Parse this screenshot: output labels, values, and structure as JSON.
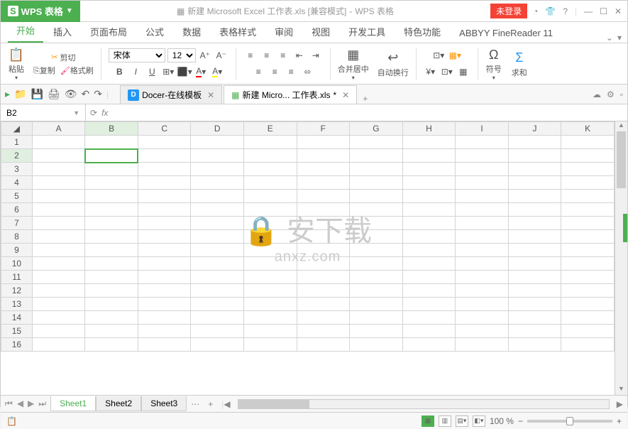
{
  "app": {
    "brand": "WPS 表格",
    "title_doc": "新建 Microsoft Excel 工作表.xls [兼容模式]",
    "title_suffix": "WPS 表格",
    "login": "未登录"
  },
  "menu_tabs": [
    "开始",
    "插入",
    "页面布局",
    "公式",
    "数据",
    "表格样式",
    "审阅",
    "视图",
    "开发工具",
    "特色功能",
    "ABBYY FineReader 11"
  ],
  "menu_active": 0,
  "ribbon": {
    "paste": "粘贴",
    "cut": "剪切",
    "copy": "复制",
    "format_painter": "格式刷",
    "font_name": "宋体",
    "font_size": "12",
    "merge": "合并居中",
    "wrap": "自动换行",
    "symbol": "符号",
    "sum": "求和"
  },
  "doc_tabs": [
    {
      "label": "Docer-在线模板",
      "type": "docer"
    },
    {
      "label": "新建 Micro... 工作表.xls",
      "type": "xls",
      "active": true
    }
  ],
  "ref": {
    "cell": "B2",
    "fx": "fx"
  },
  "columns": [
    "A",
    "B",
    "C",
    "D",
    "E",
    "F",
    "G",
    "H",
    "I",
    "J",
    "K"
  ],
  "rows_count": 16,
  "selected": {
    "row": 2,
    "col": "B"
  },
  "sheets": [
    "Sheet1",
    "Sheet2",
    "Sheet3"
  ],
  "sheet_active": 0,
  "status": {
    "zoom": "100 %"
  },
  "watermark": {
    "main": "安下载",
    "sub": "anxz.com"
  }
}
